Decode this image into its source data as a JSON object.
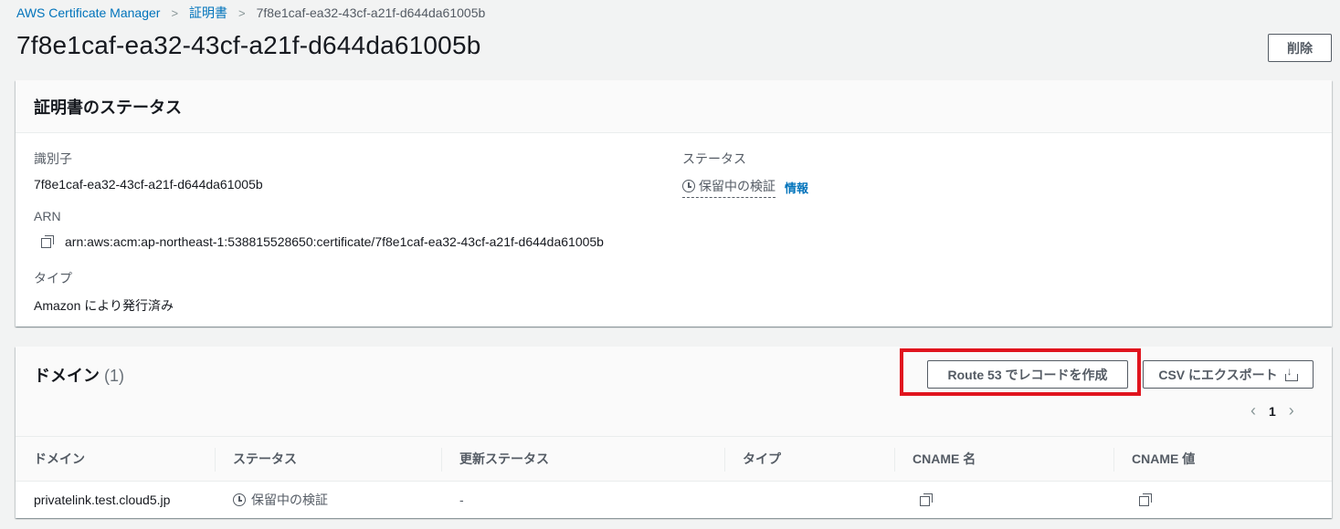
{
  "breadcrumb": {
    "root": "AWS Certificate Manager",
    "parent": "証明書",
    "current": "7f8e1caf-ea32-43cf-a21f-d644da61005b"
  },
  "page": {
    "title": "7f8e1caf-ea32-43cf-a21f-d644da61005b",
    "delete_label": "削除"
  },
  "status_panel": {
    "heading": "証明書のステータス",
    "identifier_label": "識別子",
    "identifier_value": "7f8e1caf-ea32-43cf-a21f-d644da61005b",
    "status_label": "ステータス",
    "status_value": "保留中の検証",
    "info_link": "情報",
    "arn_label": "ARN",
    "arn_value": "arn:aws:acm:ap-northeast-1:538815528650:certificate/7f8e1caf-ea32-43cf-a21f-d644da61005b",
    "type_label": "タイプ",
    "type_value": "Amazon により発行済み"
  },
  "domain_panel": {
    "heading": "ドメイン",
    "count": "(1)",
    "route53_label": "Route 53 でレコードを作成",
    "csv_label": "CSV にエクスポート",
    "page_number": "1",
    "columns": [
      "ドメイン",
      "ステータス",
      "更新ステータス",
      "タイプ",
      "CNAME 名",
      "CNAME 値"
    ],
    "rows": [
      {
        "domain": "privatelink.test.cloud5.jp",
        "status": "保留中の検証",
        "renewal_status": "-",
        "type": ""
      }
    ]
  },
  "colors": {
    "link": "#0073bb",
    "highlight": "#e0141e",
    "text": "#16191f",
    "muted": "#545b64"
  }
}
